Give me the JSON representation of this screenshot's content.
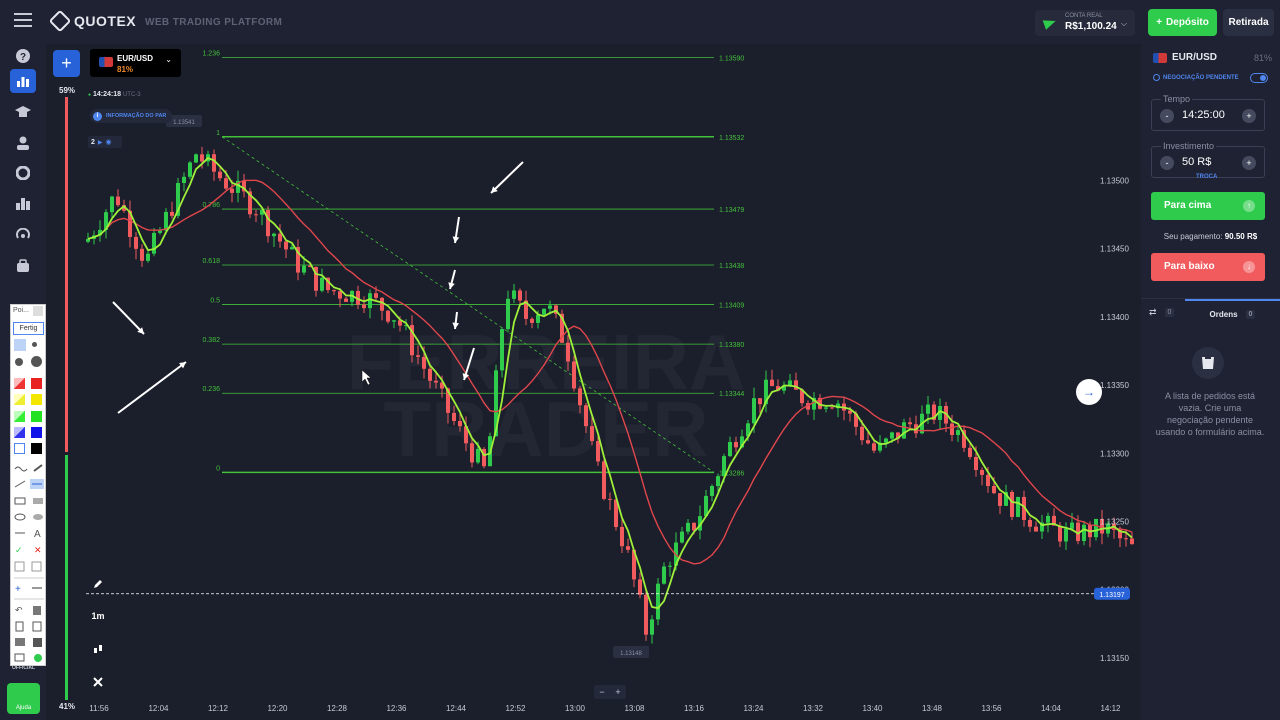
{
  "header": {
    "brand": "QUOTEX",
    "platform": "WEB TRADING PLATFORM",
    "account_label": "CONTA REAL",
    "balance": "R$1,100.24",
    "deposit_label": "Depósito",
    "withdraw_label": "Retirada"
  },
  "sidebar": {
    "icons": [
      "menu-icon",
      "help-icon",
      "chart-icon",
      "education-icon",
      "profile-icon",
      "pie-icon",
      "leaderboard-icon",
      "signal-icon",
      "market-icon"
    ],
    "help_label": "Ajuda",
    "official_label": "OFFICIAL"
  },
  "asset_tab": {
    "name": "EUR/USD",
    "payout": "81%"
  },
  "chart_meta": {
    "time": "14:24:18",
    "tz": "UTC-3",
    "info": "INFORMAÇÃO DO PAR",
    "sentiment_top": "59%",
    "sentiment_bottom": "41%",
    "timeframe": "1m",
    "indicator_count": "2",
    "current_price": "1.13197",
    "low_label": "1.13148",
    "high_label": "1.13541",
    "watermark_line1": "FERREIRA",
    "watermark_line2": "TRADER"
  },
  "tool_panel": {
    "title": "Poi...",
    "selected": "Fertig"
  },
  "chart_data": {
    "type": "candlestick",
    "ylim": [
      1.13125,
      1.136
    ],
    "yticks": [
      "1.13500",
      "1.13450",
      "1.13400",
      "1.13350",
      "1.13300",
      "1.13250",
      "1.13200",
      "1.13150"
    ],
    "xticks": [
      "11:56",
      "12:04",
      "12:12",
      "12:20",
      "12:28",
      "12:36",
      "12:44",
      "12:52",
      "13:00",
      "13:08",
      "13:16",
      "13:24",
      "13:32",
      "13:40",
      "13:48",
      "13:56",
      "14:04",
      "14:12"
    ],
    "fibonacci": [
      {
        "level": "1.236",
        "price": "1.13590"
      },
      {
        "level": "1",
        "price": "1.13532"
      },
      {
        "level": "0.786",
        "price": "1.13479"
      },
      {
        "level": "0.618",
        "price": "1.13438"
      },
      {
        "level": "0.5",
        "price": "1.13409"
      },
      {
        "level": "0.382",
        "price": "1.13380"
      },
      {
        "level": "0.236",
        "price": "1.13344"
      },
      {
        "level": "0",
        "price": "1.13286"
      }
    ],
    "series_colors": {
      "up": "#2ecb4c",
      "down": "#f25b5e",
      "fast_ma": "#9ef03a",
      "slow_ma": "#e0474c",
      "fib": "#43c13b"
    }
  },
  "right_panel": {
    "asset": "EUR/USD",
    "payout": "81%",
    "pending_label": "NEGOCIAÇÃO PENDENTE",
    "time_label": "Tempo",
    "time_value": "14:25:00",
    "invest_label": "Investimento",
    "invest_value": "50 R$",
    "swap_label": "TROCA",
    "up_label": "Para cima",
    "down_label": "Para baixo",
    "payout_label": "Seu pagamento:",
    "payout_value": "90.50 R$",
    "trades_count": "0",
    "orders_label": "Ordens",
    "orders_count": "0",
    "empty_text": "A lista de pedidos está vazia. Crie uma negociação pendente usando o formulário acima."
  }
}
